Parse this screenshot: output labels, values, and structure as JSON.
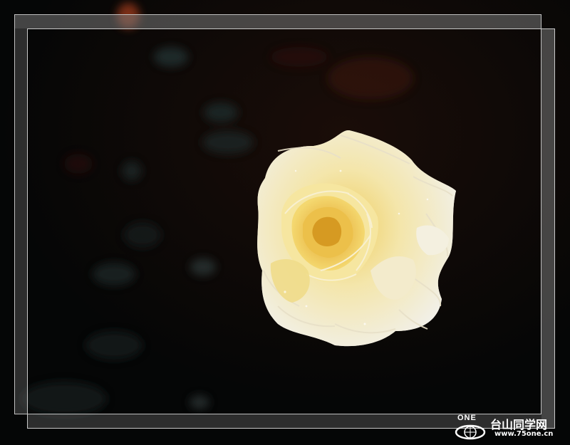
{
  "photo": {
    "subject": "rose-icon",
    "colors": {
      "background": "#050606",
      "petal_light": "#f4f2e6",
      "petal_yellow": "#f2d66a",
      "petal_core": "#e8b53a",
      "leaf": "#1c2a2a",
      "blur_red": "#5a1a10"
    }
  },
  "watermark": {
    "logo_text": "ONE",
    "site_name": "台山同学网",
    "url": "www.75one.cn"
  }
}
